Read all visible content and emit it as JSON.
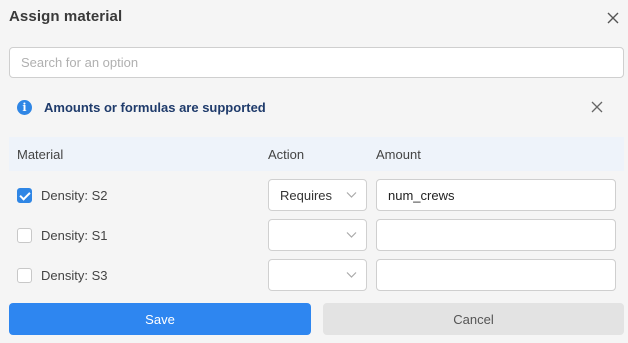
{
  "dialog": {
    "title": "Assign material"
  },
  "search": {
    "placeholder": "Search for an option",
    "value": ""
  },
  "info": {
    "text": "Amounts or formulas are supported"
  },
  "table": {
    "headers": {
      "material": "Material",
      "action": "Action",
      "amount": "Amount"
    },
    "rows": [
      {
        "label": "Density: S2",
        "checked": true,
        "action": "Requires",
        "amount": "num_crews"
      },
      {
        "label": "Density: S1",
        "checked": false,
        "action": "",
        "amount": ""
      },
      {
        "label": "Density: S3",
        "checked": false,
        "action": "",
        "amount": ""
      }
    ]
  },
  "buttons": {
    "save": "Save",
    "cancel": "Cancel"
  },
  "colors": {
    "accent": "#2e86f0",
    "info_text": "#1f3b6b",
    "header_bg": "#eef3fa"
  }
}
